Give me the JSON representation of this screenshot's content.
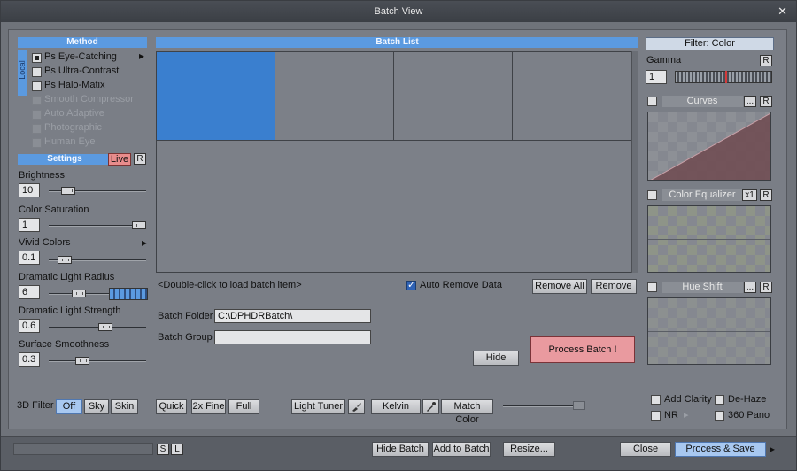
{
  "window": {
    "title": "Batch View",
    "close_glyph": "✕"
  },
  "method": {
    "header": "Method",
    "local_tab": "Local",
    "items": [
      {
        "label": "Ps Eye-Catching",
        "checked": true,
        "enabled": true,
        "has_arrow": true
      },
      {
        "label": "Ps Ultra-Contrast",
        "checked": false,
        "enabled": true
      },
      {
        "label": "Ps Halo-Matix",
        "checked": false,
        "enabled": true
      },
      {
        "label": "Smooth Compressor",
        "checked": false,
        "enabled": false
      },
      {
        "label": "Auto Adaptive",
        "checked": false,
        "enabled": false
      },
      {
        "label": "Photographic",
        "checked": false,
        "enabled": false
      },
      {
        "label": "Human Eye",
        "checked": false,
        "enabled": false
      }
    ],
    "arrow_glyph": "▸"
  },
  "settings": {
    "header": "Settings",
    "live_label": "Live",
    "reset_label": "R",
    "sliders": [
      {
        "label": "Brightness",
        "value": "10"
      },
      {
        "label": "Color Saturation",
        "value": "1"
      },
      {
        "label": "Vivid Colors",
        "value": "0.1",
        "has_arrow": true
      },
      {
        "label": "Dramatic Light Radius",
        "value": "6"
      },
      {
        "label": "Dramatic Light Strength",
        "value": "0.6"
      },
      {
        "label": "Surface Smoothness",
        "value": "0.3"
      }
    ]
  },
  "batch": {
    "header": "Batch List",
    "hint": "<Double-click to load batch item>",
    "auto_remove_label": "Auto Remove Data",
    "remove_all_label": "Remove All",
    "remove_label": "Remove",
    "folder_label": "Batch Folder",
    "folder_value": "C:\\DPHDRBatch\\",
    "group_label": "Batch Group",
    "group_value": "",
    "hide_label": "Hide",
    "process_label": "Process Batch !"
  },
  "right_panel": {
    "filter_label": "Filter: Color",
    "gamma_label": "Gamma",
    "gamma_value": "1",
    "reset_label": "R",
    "curves_label": "Curves",
    "color_eq_label": "Color Equalizer",
    "x1_label": "x1",
    "hue_shift_label": "Hue Shift",
    "dots_label": "..."
  },
  "bottom_row": {
    "filter3d_label": "3D Filter",
    "off_label": "Off",
    "sky_label": "Sky",
    "skin_label": "Skin",
    "quick_label": "Quick",
    "fine_label": "2x Fine",
    "full_label": "Full",
    "light_tuner_label": "Light Tuner",
    "kelvin_label": "Kelvin",
    "match_color_label": "Match Color",
    "add_clarity_label": "Add Clarity",
    "dehaze_label": "De-Haze",
    "nr_label": "NR",
    "pano_label": "360 Pano"
  },
  "footer": {
    "s_label": "S",
    "l_label": "L",
    "hide_batch_label": "Hide Batch",
    "add_to_batch_label": "Add to Batch",
    "resize_label": "Resize...",
    "close_label": "Close",
    "process_save_label": "Process & Save",
    "arrow_glyph": "▸"
  }
}
